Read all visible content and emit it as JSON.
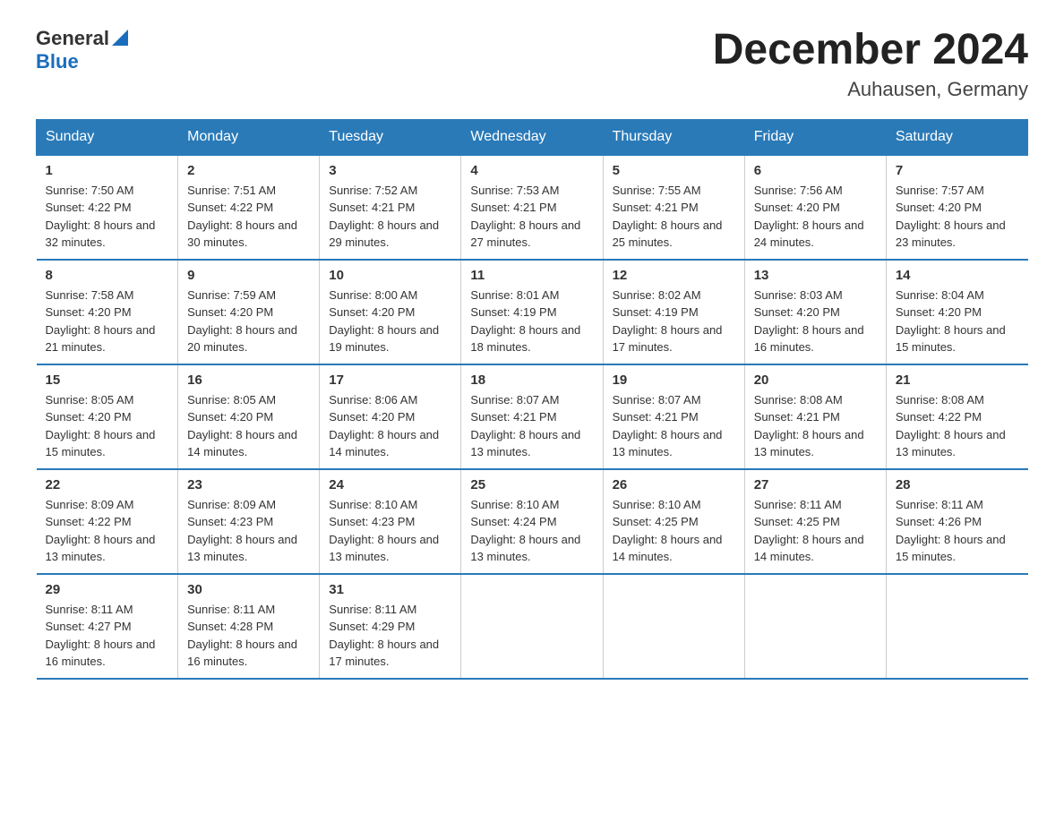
{
  "logo": {
    "general": "General",
    "blue": "Blue"
  },
  "title": {
    "month_year": "December 2024",
    "location": "Auhausen, Germany"
  },
  "headers": [
    "Sunday",
    "Monday",
    "Tuesday",
    "Wednesday",
    "Thursday",
    "Friday",
    "Saturday"
  ],
  "weeks": [
    [
      {
        "day": "1",
        "sunrise": "7:50 AM",
        "sunset": "4:22 PM",
        "daylight": "8 hours and 32 minutes."
      },
      {
        "day": "2",
        "sunrise": "7:51 AM",
        "sunset": "4:22 PM",
        "daylight": "8 hours and 30 minutes."
      },
      {
        "day": "3",
        "sunrise": "7:52 AM",
        "sunset": "4:21 PM",
        "daylight": "8 hours and 29 minutes."
      },
      {
        "day": "4",
        "sunrise": "7:53 AM",
        "sunset": "4:21 PM",
        "daylight": "8 hours and 27 minutes."
      },
      {
        "day": "5",
        "sunrise": "7:55 AM",
        "sunset": "4:21 PM",
        "daylight": "8 hours and 25 minutes."
      },
      {
        "day": "6",
        "sunrise": "7:56 AM",
        "sunset": "4:20 PM",
        "daylight": "8 hours and 24 minutes."
      },
      {
        "day": "7",
        "sunrise": "7:57 AM",
        "sunset": "4:20 PM",
        "daylight": "8 hours and 23 minutes."
      }
    ],
    [
      {
        "day": "8",
        "sunrise": "7:58 AM",
        "sunset": "4:20 PM",
        "daylight": "8 hours and 21 minutes."
      },
      {
        "day": "9",
        "sunrise": "7:59 AM",
        "sunset": "4:20 PM",
        "daylight": "8 hours and 20 minutes."
      },
      {
        "day": "10",
        "sunrise": "8:00 AM",
        "sunset": "4:20 PM",
        "daylight": "8 hours and 19 minutes."
      },
      {
        "day": "11",
        "sunrise": "8:01 AM",
        "sunset": "4:19 PM",
        "daylight": "8 hours and 18 minutes."
      },
      {
        "day": "12",
        "sunrise": "8:02 AM",
        "sunset": "4:19 PM",
        "daylight": "8 hours and 17 minutes."
      },
      {
        "day": "13",
        "sunrise": "8:03 AM",
        "sunset": "4:20 PM",
        "daylight": "8 hours and 16 minutes."
      },
      {
        "day": "14",
        "sunrise": "8:04 AM",
        "sunset": "4:20 PM",
        "daylight": "8 hours and 15 minutes."
      }
    ],
    [
      {
        "day": "15",
        "sunrise": "8:05 AM",
        "sunset": "4:20 PM",
        "daylight": "8 hours and 15 minutes."
      },
      {
        "day": "16",
        "sunrise": "8:05 AM",
        "sunset": "4:20 PM",
        "daylight": "8 hours and 14 minutes."
      },
      {
        "day": "17",
        "sunrise": "8:06 AM",
        "sunset": "4:20 PM",
        "daylight": "8 hours and 14 minutes."
      },
      {
        "day": "18",
        "sunrise": "8:07 AM",
        "sunset": "4:21 PM",
        "daylight": "8 hours and 13 minutes."
      },
      {
        "day": "19",
        "sunrise": "8:07 AM",
        "sunset": "4:21 PM",
        "daylight": "8 hours and 13 minutes."
      },
      {
        "day": "20",
        "sunrise": "8:08 AM",
        "sunset": "4:21 PM",
        "daylight": "8 hours and 13 minutes."
      },
      {
        "day": "21",
        "sunrise": "8:08 AM",
        "sunset": "4:22 PM",
        "daylight": "8 hours and 13 minutes."
      }
    ],
    [
      {
        "day": "22",
        "sunrise": "8:09 AM",
        "sunset": "4:22 PM",
        "daylight": "8 hours and 13 minutes."
      },
      {
        "day": "23",
        "sunrise": "8:09 AM",
        "sunset": "4:23 PM",
        "daylight": "8 hours and 13 minutes."
      },
      {
        "day": "24",
        "sunrise": "8:10 AM",
        "sunset": "4:23 PM",
        "daylight": "8 hours and 13 minutes."
      },
      {
        "day": "25",
        "sunrise": "8:10 AM",
        "sunset": "4:24 PM",
        "daylight": "8 hours and 13 minutes."
      },
      {
        "day": "26",
        "sunrise": "8:10 AM",
        "sunset": "4:25 PM",
        "daylight": "8 hours and 14 minutes."
      },
      {
        "day": "27",
        "sunrise": "8:11 AM",
        "sunset": "4:25 PM",
        "daylight": "8 hours and 14 minutes."
      },
      {
        "day": "28",
        "sunrise": "8:11 AM",
        "sunset": "4:26 PM",
        "daylight": "8 hours and 15 minutes."
      }
    ],
    [
      {
        "day": "29",
        "sunrise": "8:11 AM",
        "sunset": "4:27 PM",
        "daylight": "8 hours and 16 minutes."
      },
      {
        "day": "30",
        "sunrise": "8:11 AM",
        "sunset": "4:28 PM",
        "daylight": "8 hours and 16 minutes."
      },
      {
        "day": "31",
        "sunrise": "8:11 AM",
        "sunset": "4:29 PM",
        "daylight": "8 hours and 17 minutes."
      },
      null,
      null,
      null,
      null
    ]
  ]
}
